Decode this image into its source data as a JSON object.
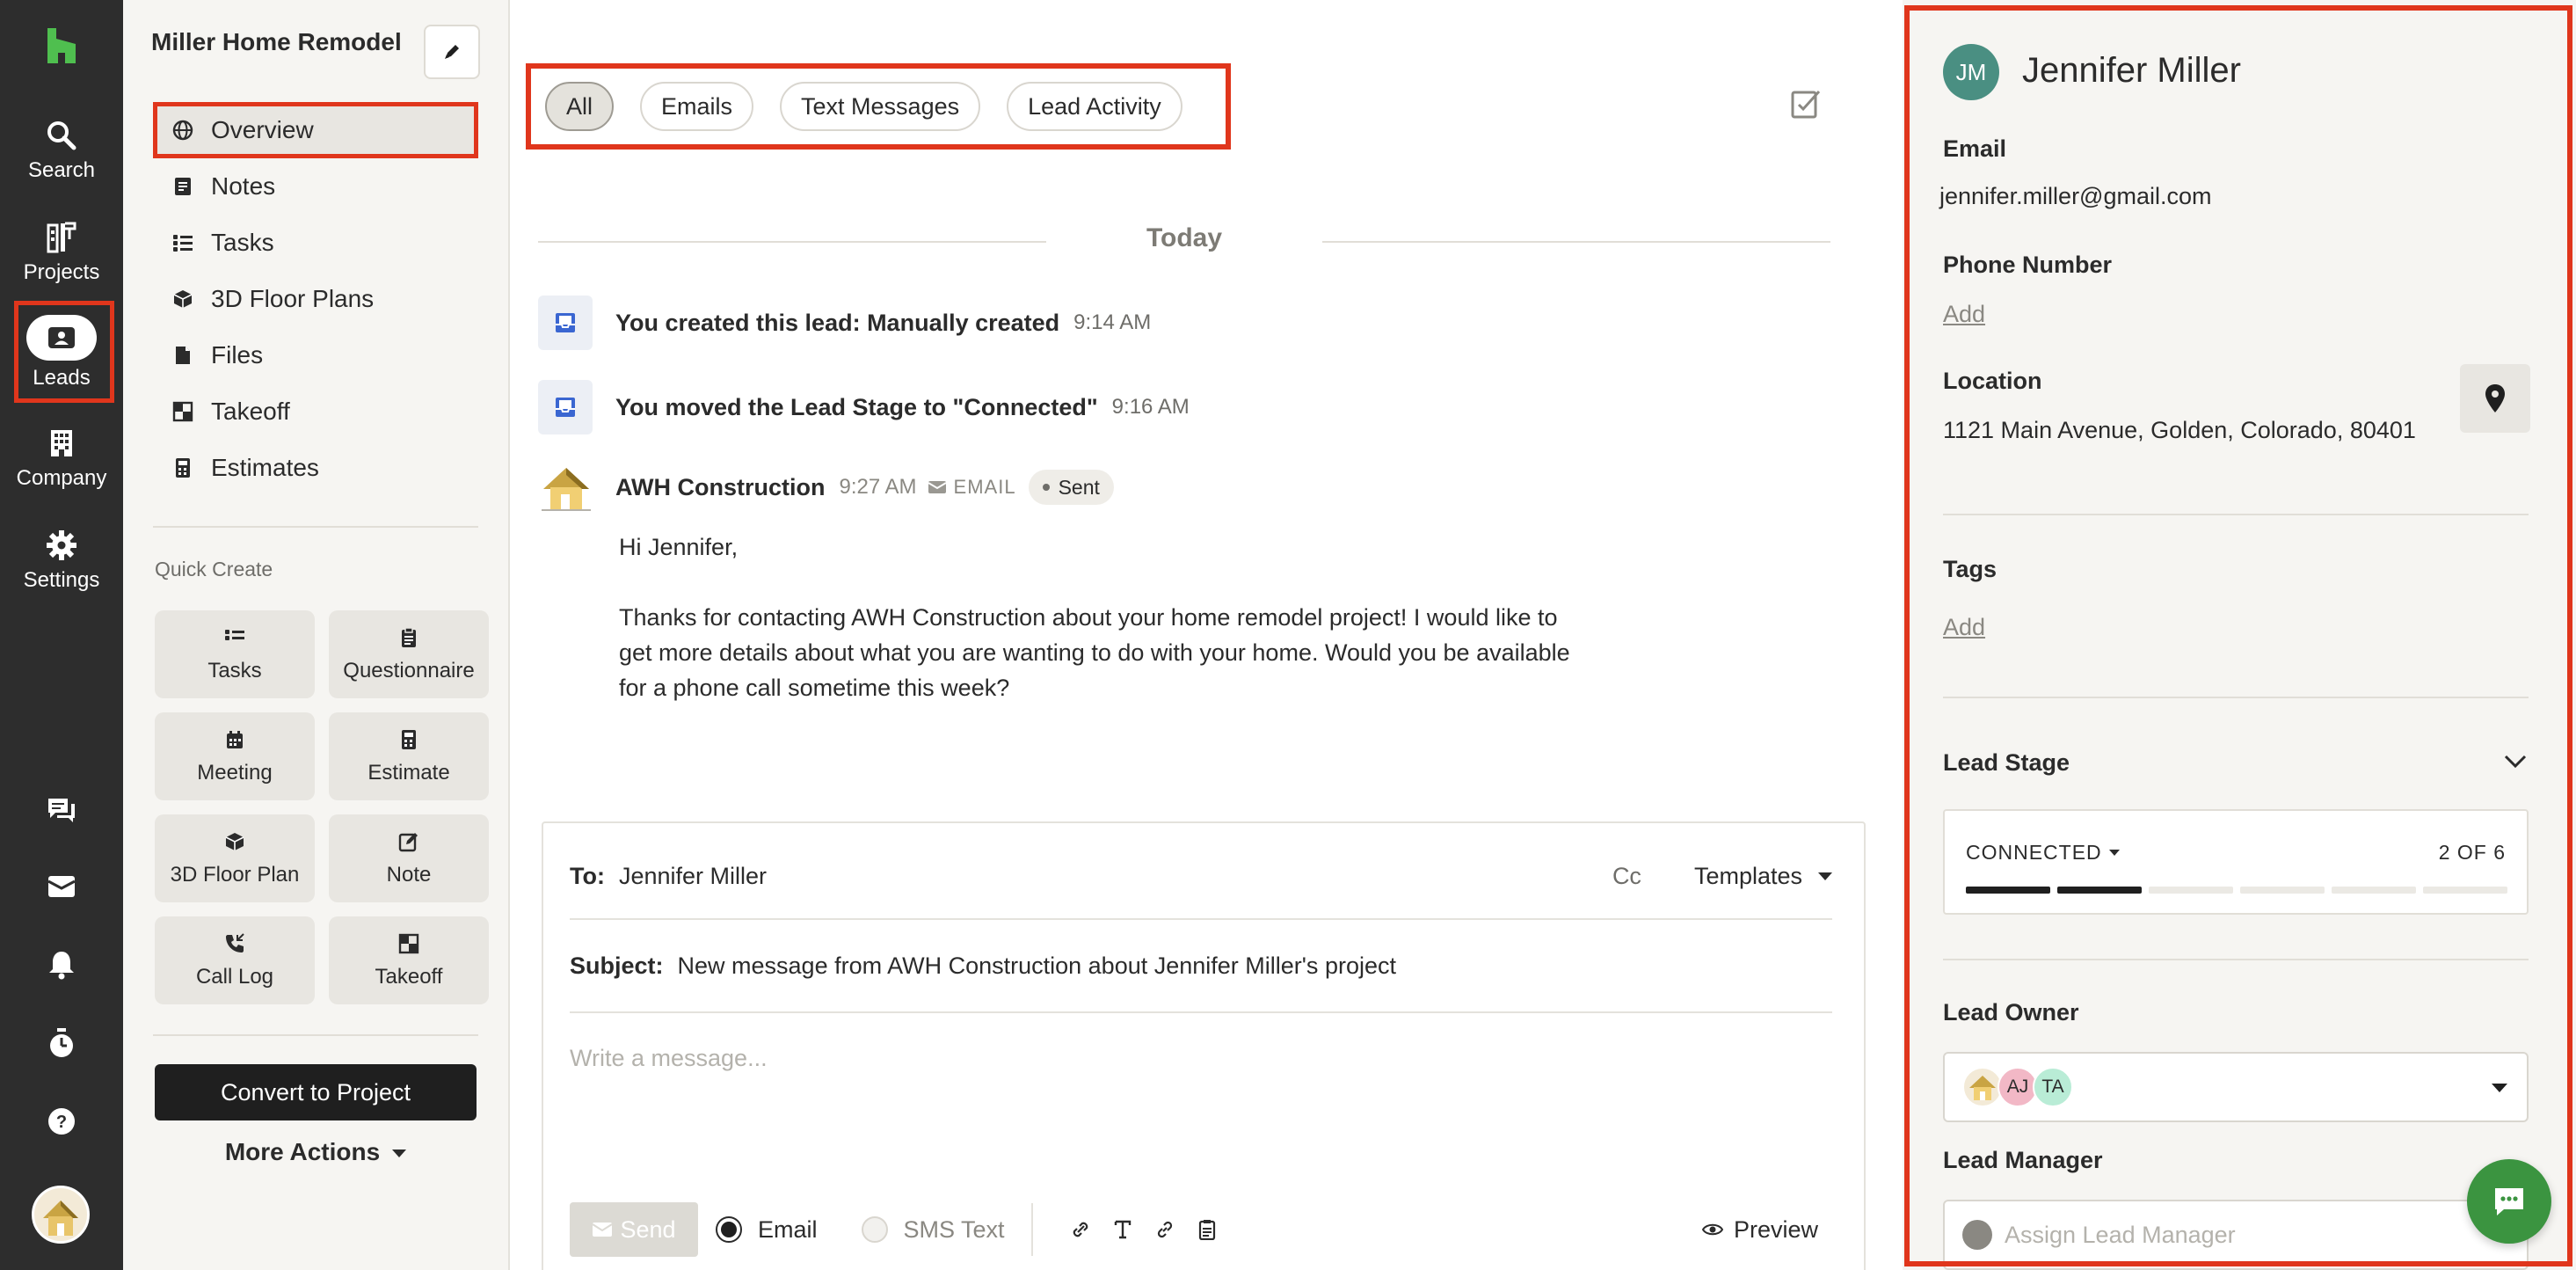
{
  "rail": {
    "items": [
      {
        "label": "Search",
        "icon": "search-icon"
      },
      {
        "label": "Projects",
        "icon": "projects-icon"
      },
      {
        "label": "Leads",
        "icon": "leads-icon",
        "active": true
      },
      {
        "label": "Company",
        "icon": "building-icon"
      },
      {
        "label": "Settings",
        "icon": "gear-icon"
      }
    ],
    "bottom_icons": [
      "chat-bubbles-icon",
      "inbox-icon",
      "bell-icon",
      "timer-icon",
      "help-icon"
    ]
  },
  "sidebar": {
    "title": "Miller Home Remodel",
    "nav": [
      {
        "label": "Overview",
        "icon": "globe-icon",
        "active": true
      },
      {
        "label": "Notes",
        "icon": "notes-icon"
      },
      {
        "label": "Tasks",
        "icon": "tasks-icon"
      },
      {
        "label": "3D Floor Plans",
        "icon": "cube-icon"
      },
      {
        "label": "Files",
        "icon": "file-icon"
      },
      {
        "label": "Takeoff",
        "icon": "takeoff-icon"
      },
      {
        "label": "Estimates",
        "icon": "calculator-icon"
      }
    ],
    "quick_create_label": "Quick Create",
    "quick_create": [
      {
        "label": "Tasks",
        "icon": "tasks-icon"
      },
      {
        "label": "Questionnaire",
        "icon": "clipboard-icon"
      },
      {
        "label": "Meeting",
        "icon": "calendar-icon"
      },
      {
        "label": "Estimate",
        "icon": "calculator-icon"
      },
      {
        "label": "3D Floor Plan",
        "icon": "cube-icon"
      },
      {
        "label": "Note",
        "icon": "note-edit-icon"
      },
      {
        "label": "Call Log",
        "icon": "phone-icon"
      },
      {
        "label": "Takeoff",
        "icon": "takeoff-icon"
      }
    ],
    "convert_label": "Convert to Project",
    "more_actions_label": "More Actions"
  },
  "feed": {
    "filters": [
      {
        "label": "All",
        "active": true
      },
      {
        "label": "Emails"
      },
      {
        "label": "Text Messages"
      },
      {
        "label": "Lead Activity"
      }
    ],
    "date_heading": "Today",
    "activities": [
      {
        "text": "You created this lead: Manually created",
        "time": "9:14 AM"
      },
      {
        "text": "You moved the Lead Stage to \"Connected\"",
        "time": "9:16 AM"
      }
    ],
    "email": {
      "from": "AWH Construction",
      "time": "9:27 AM",
      "kind": "EMAIL",
      "status": "Sent",
      "greeting": "Hi Jennifer,",
      "line1": "Thanks for contacting AWH Construction about your home remodel project! I would like to",
      "line2": "get more details about what you are wanting to do with your home. Would you be available",
      "line3": "for a phone call sometime this week?"
    },
    "composer": {
      "to_label": "To:",
      "to_value": "Jennifer Miller",
      "cc_label": "Cc",
      "templates_label": "Templates",
      "subject_label": "Subject:",
      "subject_value": "New message from AWH Construction about Jennifer Miller's project",
      "placeholder": "Write a message...",
      "send_label": "Send",
      "email_option": "Email",
      "sms_option": "SMS Text",
      "preview_label": "Preview"
    }
  },
  "contact": {
    "initials": "JM",
    "name": "Jennifer Miller",
    "email_label": "Email",
    "email": "jennifer.miller@gmail.com",
    "phone_label": "Phone Number",
    "phone_add": "Add",
    "location_label": "Location",
    "location": "1121 Main Avenue, Golden, Colorado, 80401",
    "tags_label": "Tags",
    "tags_add": "Add",
    "stage_label": "Lead Stage",
    "stage_value": "CONNECTED",
    "stage_progress": "2 OF 6",
    "stage_steps_total": 6,
    "stage_steps_done": 2,
    "owner_label": "Lead Owner",
    "owners": [
      "AJ",
      "TA"
    ],
    "manager_label": "Lead Manager",
    "manager_placeholder": "Assign Lead Manager"
  },
  "colors": {
    "highlight": "#e0361c",
    "brand_green": "#3b9440",
    "rail_bg": "#2d2d2d"
  }
}
